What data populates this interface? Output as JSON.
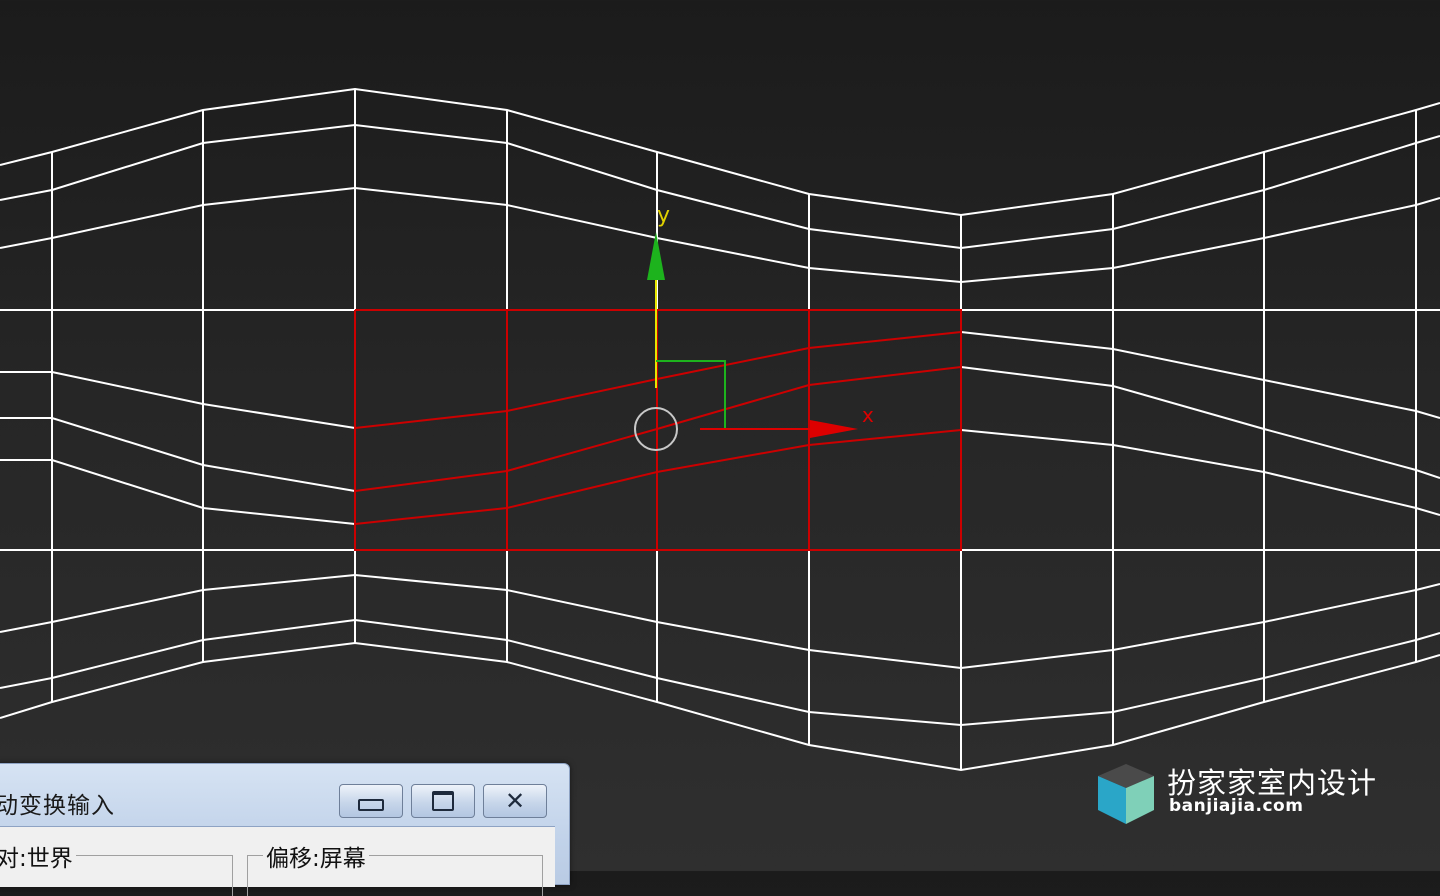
{
  "viewport": {
    "axis_y_label": "y",
    "axis_x_label": "x",
    "colors": {
      "wire": "#ffffff",
      "selection": "#cc0000",
      "gizmo_y": "#1db31d",
      "gizmo_y_shaft": "#e0e000",
      "gizmo_x": "#dd0000",
      "pivot": "#c8c8c8"
    }
  },
  "dialog": {
    "title": "动变换输入",
    "minimize_icon": "minimize-icon",
    "maximize_icon": "maximize-icon",
    "close_icon": "close-icon",
    "left_group_label": "对:世界",
    "right_group_label": "偏移:屏幕"
  },
  "watermark": {
    "title": "扮家家室内设计",
    "url": "banjiajia.com",
    "logo_icon": "cube-logo-icon"
  }
}
